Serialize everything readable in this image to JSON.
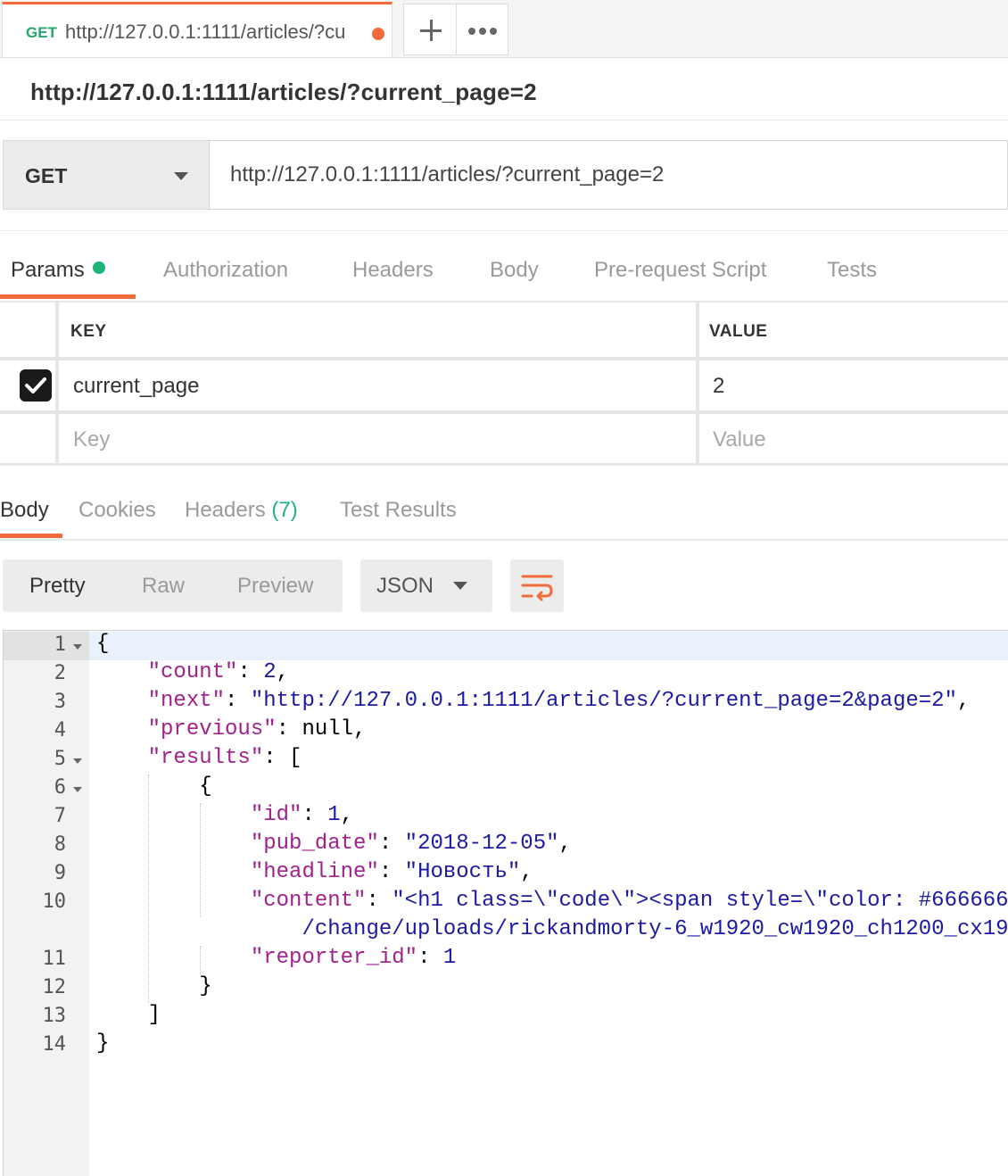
{
  "tab": {
    "method": "GET",
    "url": "http://127.0.0.1:1111/articles/?cu",
    "new_tab_label": "+"
  },
  "request_name": "http://127.0.0.1:1111/articles/?current_page=2",
  "request": {
    "method": "GET",
    "url": "http://127.0.0.1:1111/articles/?current_page=2"
  },
  "request_tabs": [
    "Params",
    "Authorization",
    "Headers",
    "Body",
    "Pre-request Script",
    "Tests"
  ],
  "params": {
    "headers": {
      "key": "KEY",
      "value": "VALUE"
    },
    "rows": [
      {
        "key": "current_page",
        "value": "2",
        "checked": true
      }
    ],
    "placeholder": {
      "key": "Key",
      "value": "Value"
    }
  },
  "response_tabs": {
    "body": "Body",
    "cookies": "Cookies",
    "headers": "Headers",
    "headers_count": "(7)",
    "test_results": "Test Results"
  },
  "view_modes": [
    "Pretty",
    "Raw",
    "Preview"
  ],
  "format": "JSON",
  "icons": {
    "wrap": "wrap-lines-icon",
    "method_dropdown": "chevron-down-icon",
    "format_dropdown": "chevron-down-icon",
    "more": "more-icon",
    "unsaved": "unsaved-dot-icon",
    "checkbox": "checkbox-checked-icon"
  },
  "colors": {
    "accent": "#f26b3a",
    "method_get": "#26a66b",
    "status_green": "#1eb37a",
    "json_key": "#a31f8c",
    "json_string": "#1a1aa6"
  },
  "response": {
    "lines": [
      "1",
      "2",
      "3",
      "4",
      "5",
      "6",
      "7",
      "8",
      "9",
      "10",
      "11",
      "12",
      "13",
      "14"
    ],
    "code": {
      "open_brace": "{",
      "count_key": "\"count\"",
      "count_val": "2",
      "next_key": "\"next\"",
      "next_val": "\"http://127.0.0.1:1111/articles/?current_page=2&page=2\"",
      "previous_key": "\"previous\"",
      "previous_val": "null",
      "results_key": "\"results\"",
      "results_open": "[",
      "obj_open": "{",
      "id_key": "\"id\"",
      "id_val": "1",
      "pub_date_key": "\"pub_date\"",
      "pub_date_val": "\"2018-12-05\"",
      "headline_key": "\"headline\"",
      "headline_val": "\"Новость\"",
      "content_key": "\"content\"",
      "content_val": "\"<h1 class=\\\"code\\\"><span style=\\\"color: #666666",
      "content_wrap": "/change/uploads/rickandmorty-6_w1920_cw1920_ch1200_cx19",
      "reporter_key": "\"reporter_id\"",
      "reporter_val": "1",
      "obj_close": "}",
      "results_close": "]",
      "close_brace": "}"
    }
  }
}
